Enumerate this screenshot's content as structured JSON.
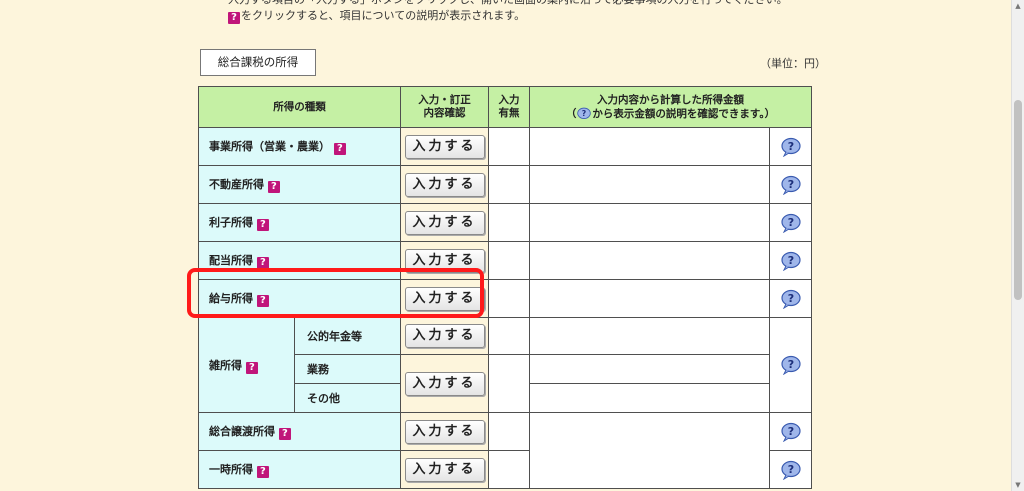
{
  "intro": {
    "line1": "入力する項目の「入力する」ボタンをクリックし、開いた画面の案内に沿って必要事項の入力を行ってください。",
    "line2_text": "をクリックすると、項目についての説明が表示されます。",
    "qmark": "?"
  },
  "section": {
    "title": "総合課税の所得",
    "unit": "（単位：円）"
  },
  "table": {
    "headers": {
      "type": "所得の種類",
      "input_line1": "入力・訂正",
      "input_line2": "内容確認",
      "has_line1": "入力",
      "has_line2": "有無",
      "amount_line1": "入力内容から計算した所得金額",
      "amount_line2_pre": "（",
      "amount_line2_post": "から表示金額の説明を確認できます。）"
    },
    "button_label": "入力する",
    "qmark": "?",
    "rows": {
      "business": "事業所得（営業・農業）",
      "real_estate": "不動産所得",
      "interest": "利子所得",
      "dividend": "配当所得",
      "salary": "給与所得",
      "misc": "雑所得",
      "misc_pension": "公的年金等",
      "misc_work": "業務",
      "misc_other": "その他",
      "transfer": "総合譲渡所得",
      "temporary": "一時所得"
    }
  },
  "colors": {
    "header_bg": "#c5f0a4",
    "name_bg": "#dcfafa",
    "page_bg": "#fdf5dc",
    "highlight": "#ff1a1a",
    "qmark_bg": "#c0157a"
  }
}
